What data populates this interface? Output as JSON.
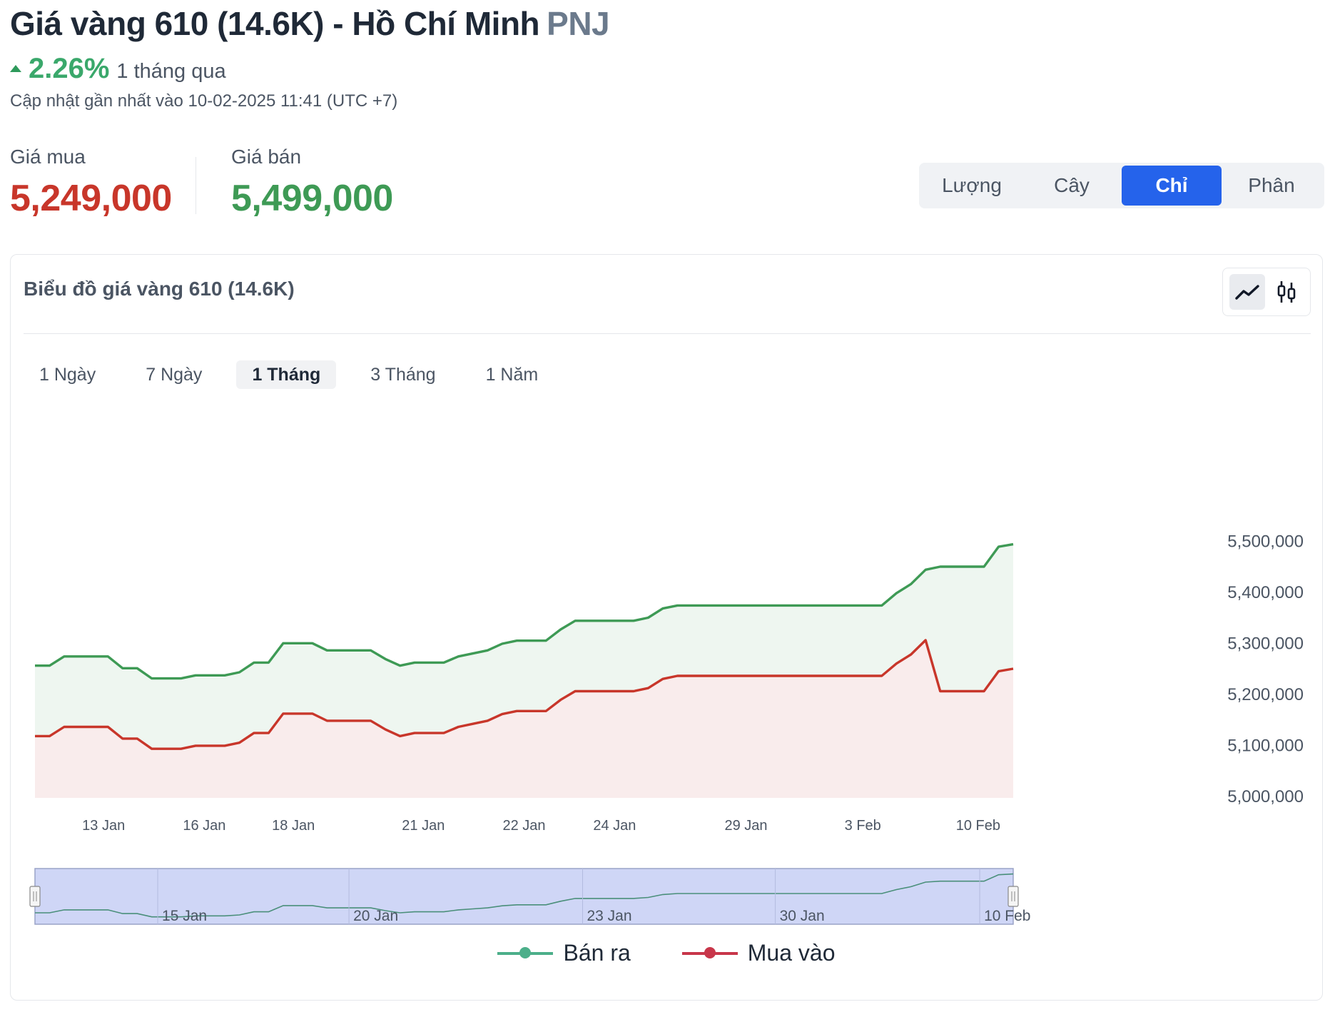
{
  "header": {
    "title": "Giá vàng 610 (14.6K) - Hồ Chí Minh",
    "brand": "PNJ",
    "change_pct": "2.26%",
    "change_period": "1 tháng qua",
    "updated": "Cập nhật gần nhất vào 10-02-2025 11:41 (UTC +7)"
  },
  "prices": {
    "buy_label": "Giá mua",
    "buy_value": "5,249,000",
    "sell_label": "Giá bán",
    "sell_value": "5,499,000"
  },
  "unit_tabs": [
    {
      "label": "Lượng",
      "active": false
    },
    {
      "label": "Cây",
      "active": false
    },
    {
      "label": "Chỉ",
      "active": true
    },
    {
      "label": "Phân",
      "active": false
    }
  ],
  "card": {
    "title": "Biểu đồ giá vàng 610 (14.6K)"
  },
  "range_tabs": [
    {
      "label": "1 Ngày",
      "active": false
    },
    {
      "label": "7 Ngày",
      "active": false
    },
    {
      "label": "1 Tháng",
      "active": true
    },
    {
      "label": "3 Tháng",
      "active": false
    },
    {
      "label": "1 Năm",
      "active": false
    }
  ],
  "colors": {
    "sell_line": "#3e9a55",
    "buy_line": "#c8362a",
    "accent": "#2563eb",
    "navigator_fill": "#cfd6f6",
    "legend_sell": "#4caf8a",
    "legend_buy": "#c8364a"
  },
  "chart_data": {
    "type": "area",
    "ylim": [
      5000000,
      5500000
    ],
    "yticks": [
      5000000,
      5100000,
      5200000,
      5300000,
      5400000,
      5500000
    ],
    "ytick_labels": [
      "5,000,000",
      "5,100,000",
      "5,200,000",
      "5,300,000",
      "5,400,000",
      "5,500,000"
    ],
    "xtick_labels": [
      "13 Jan",
      "16 Jan",
      "18 Jan",
      "21 Jan",
      "22 Jan",
      "24 Jan",
      "29 Jan",
      "3 Feb",
      "10 Feb"
    ],
    "xtick_index": [
      4.7,
      11.6,
      17.7,
      26.6,
      33.5,
      39.7,
      48.7,
      56.7,
      64.6
    ],
    "navigator_labels": [
      "15 Jan",
      "20 Jan",
      "23 Jan",
      "30 Jan",
      "10 Feb"
    ],
    "navigator_index": [
      8.7,
      21.8,
      37.8,
      51.0,
      65.0
    ],
    "series": [
      {
        "name": "Bán ra",
        "values": [
          5255000,
          5255000,
          5273000,
          5273000,
          5273000,
          5273000,
          5250000,
          5250000,
          5230000,
          5230000,
          5230000,
          5236000,
          5236000,
          5236000,
          5242000,
          5261000,
          5261000,
          5299000,
          5299000,
          5299000,
          5285000,
          5285000,
          5285000,
          5285000,
          5268000,
          5255000,
          5261000,
          5261000,
          5261000,
          5273000,
          5279000,
          5285000,
          5298000,
          5304000,
          5304000,
          5304000,
          5326000,
          5343000,
          5343000,
          5343000,
          5343000,
          5343000,
          5349000,
          5367000,
          5373000,
          5373000,
          5373000,
          5373000,
          5373000,
          5373000,
          5373000,
          5373000,
          5373000,
          5373000,
          5373000,
          5373000,
          5373000,
          5373000,
          5373000,
          5397000,
          5415000,
          5443000,
          5449000,
          5449000,
          5449000,
          5449000,
          5488000,
          5493000
        ]
      },
      {
        "name": "Mua vào",
        "values": [
          5117000,
          5117000,
          5135000,
          5135000,
          5135000,
          5135000,
          5112000,
          5112000,
          5092000,
          5092000,
          5092000,
          5098000,
          5098000,
          5098000,
          5104000,
          5123000,
          5123000,
          5161000,
          5161000,
          5161000,
          5147000,
          5147000,
          5147000,
          5147000,
          5130000,
          5117000,
          5123000,
          5123000,
          5123000,
          5135000,
          5141000,
          5147000,
          5160000,
          5166000,
          5166000,
          5166000,
          5188000,
          5205000,
          5205000,
          5205000,
          5205000,
          5205000,
          5211000,
          5229000,
          5235000,
          5235000,
          5235000,
          5235000,
          5235000,
          5235000,
          5235000,
          5235000,
          5235000,
          5235000,
          5235000,
          5235000,
          5235000,
          5235000,
          5235000,
          5259000,
          5277000,
          5305000,
          5205000,
          5205000,
          5205000,
          5205000,
          5244000,
          5249000
        ]
      }
    ]
  },
  "legend": {
    "sell_label": "Bán ra",
    "buy_label": "Mua vào"
  }
}
